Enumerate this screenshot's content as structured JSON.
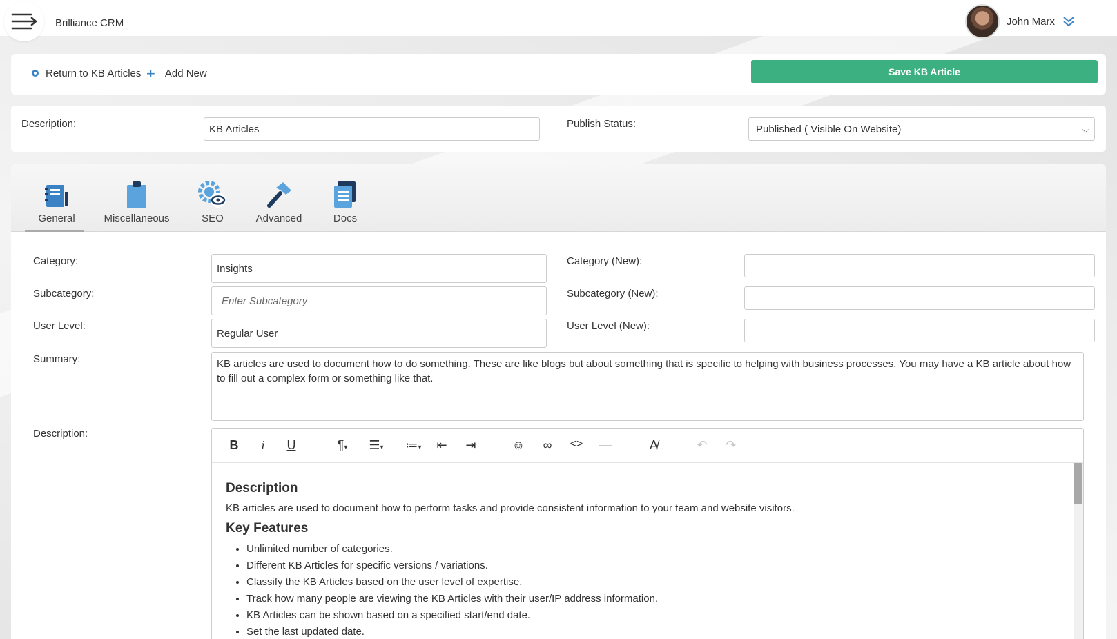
{
  "app": {
    "title": "Brilliance CRM"
  },
  "user": {
    "name": "John Marx"
  },
  "actions": {
    "return_label": "Return to KB Articles",
    "add_label": "Add New",
    "save_label": "Save KB Article"
  },
  "header_form": {
    "description_label": "Description:",
    "description_value": "KB Articles",
    "publish_label": "Publish Status:",
    "publish_value": "Published ( Visible On Website)"
  },
  "tabs": [
    {
      "label": "General",
      "icon": "notebook-icon",
      "active": true
    },
    {
      "label": "Miscellaneous",
      "icon": "clipboard-icon",
      "active": false
    },
    {
      "label": "SEO",
      "icon": "gear-eye-icon",
      "active": false
    },
    {
      "label": "Advanced",
      "icon": "hammer-icon",
      "active": false
    },
    {
      "label": "Docs",
      "icon": "documents-icon",
      "active": false
    }
  ],
  "form": {
    "category_label": "Category:",
    "category_value": "Insights",
    "subcategory_label": "Subcategory:",
    "subcategory_placeholder": "Enter Subcategory",
    "user_level_label": "User Level:",
    "user_level_value": "Regular User",
    "category_new_label": "Category (New):",
    "subcategory_new_label": "Subcategory (New):",
    "user_level_new_label": "User Level (New):",
    "summary_label": "Summary:",
    "summary_value": "KB articles are  used to document how to do something. These are like blogs  but about something that  is specific to helping with business processes. You may have a KB article about how to  fill out a complex form or something like that.",
    "description_label": "Description:"
  },
  "editor": {
    "heading1": "Description",
    "para1": "KB articles are used to document how to perform tasks and provide consistent information to your team and website visitors.",
    "heading2": "Key Features",
    "features": [
      "Unlimited number of categories.",
      "Different KB Articles for specific versions / variations.",
      "Classify the KB Articles based on the user level of expertise.",
      "Track how many people are viewing the KB Articles with their user/IP address information.",
      "KB Articles can be shown based on a specified start/end date.",
      "Set the last updated date."
    ]
  },
  "colors": {
    "accent": "#3cb081",
    "icon_blue": "#3b82c4"
  }
}
